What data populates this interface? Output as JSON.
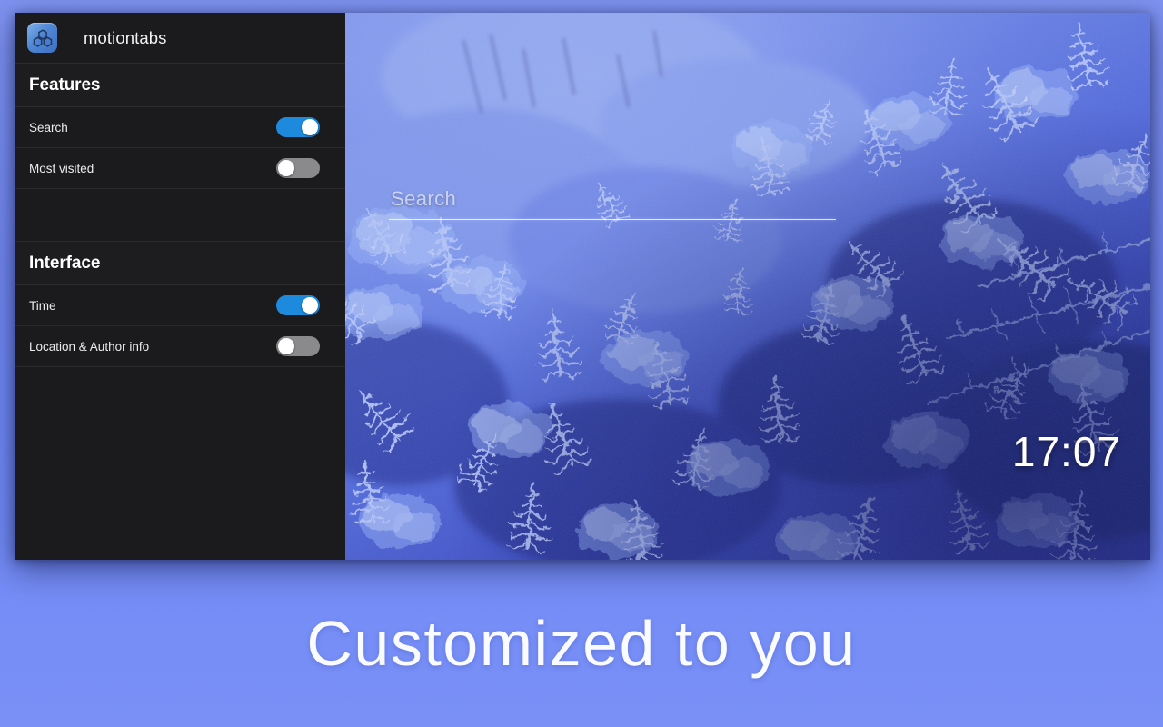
{
  "window": {
    "app_icon_name": "motiontabs-logo-icon",
    "title": "motiontabs"
  },
  "sidebar": {
    "sections": [
      {
        "heading": "Features",
        "rows": [
          {
            "label": "Search",
            "toggle_state": "on",
            "toggle_name": "toggle-search"
          },
          {
            "label": "Most visited",
            "toggle_state": "off",
            "toggle_name": "toggle-most-visited"
          }
        ]
      },
      {
        "heading": "Interface",
        "rows": [
          {
            "label": "Time",
            "toggle_state": "on",
            "toggle_name": "toggle-time"
          },
          {
            "label": "Location & Author info",
            "toggle_state": "off",
            "toggle_name": "toggle-location-author-info"
          }
        ]
      }
    ]
  },
  "preview": {
    "wallpaper_description": "aerial view of snow covered evergreen forest tinted blue",
    "search": {
      "placeholder": "Search",
      "value": ""
    },
    "clock": "17:07"
  },
  "caption": {
    "text": "Customized to you"
  },
  "colors": {
    "page_background_top": "#7f93f0",
    "page_background_bottom": "#7a90f7",
    "sidebar_background": "#1b1b1d",
    "toggle_on": "#1e8ade",
    "toggle_off": "#8a8a8d",
    "toggle_knob": "#ffffff",
    "app_icon_blue": "#4f86d4",
    "caption_text": "#ffffff"
  }
}
